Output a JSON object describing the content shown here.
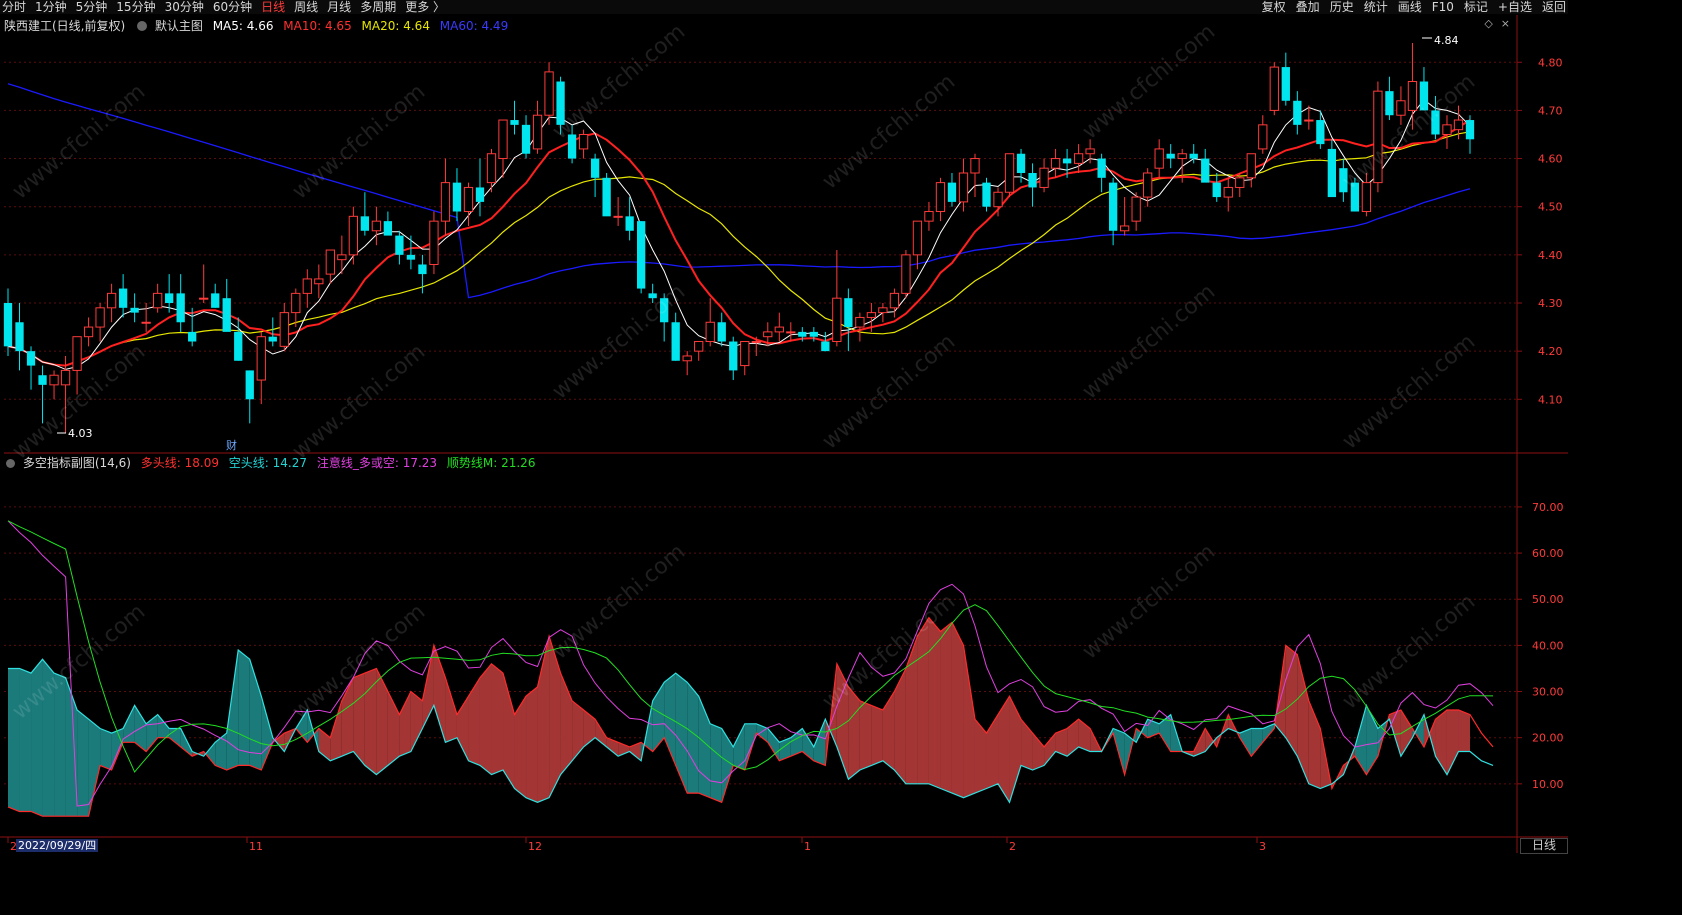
{
  "toolbar": {
    "periods": [
      "分时",
      "1分钟",
      "5分钟",
      "15分钟",
      "30分钟",
      "60分钟",
      "日线",
      "周线",
      "月线",
      "多周期",
      "更多"
    ],
    "active_period": "日线",
    "tools": [
      "复权",
      "叠加",
      "历史",
      "统计",
      "画线",
      "F10",
      "标记",
      "+自选",
      "返回"
    ]
  },
  "main_legend": {
    "stock": "陕西建工(日线,前复权)",
    "template": "默认主图",
    "ma5": "MA5: 4.66",
    "ma10": "MA10: 4.65",
    "ma20": "MA20: 4.64",
    "ma60": "MA60: 4.49"
  },
  "sub_legend": {
    "name": "多空指标副图(14,6)",
    "bull": "多头线: 18.09",
    "bear": "空头线: 14.27",
    "attention": "注意线_多或空: 17.23",
    "trend": "顺势线M: 21.26"
  },
  "price_axis": [
    "4.80",
    "4.70",
    "4.60",
    "4.50",
    "4.40",
    "4.30",
    "4.20",
    "4.10"
  ],
  "sub_axis": [
    "70.00",
    "60.00",
    "50.00",
    "40.00",
    "30.00",
    "20.00",
    "10.00"
  ],
  "annotations": {
    "high": "4.84",
    "low": "4.03",
    "event": "财"
  },
  "x_axis": {
    "labels": [
      "20",
      "11",
      "12",
      "1",
      "2",
      "3"
    ],
    "cursor_date": "2022/09/29/四"
  },
  "period_label": "日线",
  "colors": {
    "up": "#ff3b3b",
    "down": "#00e5ee",
    "ma5": "#ffffff",
    "ma10": "#ff2020",
    "ma20": "#e6e600",
    "ma60": "#1a1aff",
    "bull_fill": "#a33535",
    "bear_fill": "#1b7a7a",
    "attention": "#e040e0",
    "trend": "#22dd22"
  },
  "chart_data": {
    "type": "candlestick",
    "y_range_main": [
      4.03,
      4.84
    ],
    "y_range_sub": [
      0,
      78
    ],
    "candles": [
      [
        4.3,
        4.33,
        4.19,
        4.21
      ],
      [
        4.26,
        4.3,
        4.16,
        4.2
      ],
      [
        4.2,
        4.21,
        4.12,
        4.17
      ],
      [
        4.15,
        4.17,
        4.05,
        4.13
      ],
      [
        4.13,
        4.16,
        4.1,
        4.15
      ],
      [
        4.13,
        4.19,
        4.03,
        4.16
      ],
      [
        4.16,
        4.23,
        4.11,
        4.23
      ],
      [
        4.23,
        4.27,
        4.21,
        4.25
      ],
      [
        4.25,
        4.3,
        4.22,
        4.29
      ],
      [
        4.29,
        4.34,
        4.26,
        4.32
      ],
      [
        4.33,
        4.36,
        4.27,
        4.29
      ],
      [
        4.29,
        4.32,
        4.26,
        4.28
      ],
      [
        4.26,
        4.3,
        4.24,
        4.26
      ],
      [
        4.29,
        4.34,
        4.28,
        4.32
      ],
      [
        4.32,
        4.36,
        4.28,
        4.3
      ],
      [
        4.32,
        4.36,
        4.24,
        4.26
      ],
      [
        4.24,
        4.29,
        4.21,
        4.22
      ],
      [
        4.31,
        4.38,
        4.3,
        4.31
      ],
      [
        4.32,
        4.34,
        4.29,
        4.29
      ],
      [
        4.31,
        4.35,
        4.25,
        4.24
      ],
      [
        4.24,
        4.27,
        4.18,
        4.18
      ],
      [
        4.16,
        4.16,
        4.05,
        4.1
      ],
      [
        4.14,
        4.24,
        4.09,
        4.23
      ],
      [
        4.23,
        4.27,
        4.21,
        4.22
      ],
      [
        4.21,
        4.3,
        4.2,
        4.28
      ],
      [
        4.28,
        4.33,
        4.25,
        4.32
      ],
      [
        4.32,
        4.37,
        4.29,
        4.35
      ],
      [
        4.34,
        4.38,
        4.31,
        4.35
      ],
      [
        4.36,
        4.41,
        4.34,
        4.41
      ],
      [
        4.39,
        4.44,
        4.36,
        4.4
      ],
      [
        4.4,
        4.5,
        4.38,
        4.48
      ],
      [
        4.48,
        4.53,
        4.44,
        4.45
      ],
      [
        4.45,
        4.5,
        4.42,
        4.47
      ],
      [
        4.47,
        4.49,
        4.45,
        4.44
      ],
      [
        4.44,
        4.45,
        4.38,
        4.4
      ],
      [
        4.4,
        4.44,
        4.37,
        4.39
      ],
      [
        4.38,
        4.4,
        4.32,
        4.36
      ],
      [
        4.38,
        4.49,
        4.36,
        4.47
      ],
      [
        4.47,
        4.6,
        4.44,
        4.55
      ],
      [
        4.55,
        4.58,
        4.47,
        4.49
      ],
      [
        4.49,
        4.55,
        4.46,
        4.54
      ],
      [
        4.54,
        4.6,
        4.48,
        4.51
      ],
      [
        4.55,
        4.62,
        4.53,
        4.61
      ],
      [
        4.6,
        4.68,
        4.56,
        4.68
      ],
      [
        4.68,
        4.72,
        4.65,
        4.67
      ],
      [
        4.67,
        4.69,
        4.6,
        4.61
      ],
      [
        4.62,
        4.72,
        4.61,
        4.69
      ],
      [
        4.69,
        4.8,
        4.67,
        4.78
      ],
      [
        4.76,
        4.77,
        4.65,
        4.67
      ],
      [
        4.65,
        4.67,
        4.59,
        4.6
      ],
      [
        4.62,
        4.66,
        4.6,
        4.65
      ],
      [
        4.6,
        4.61,
        4.52,
        4.56
      ],
      [
        4.56,
        4.57,
        4.53,
        4.48
      ],
      [
        4.48,
        4.52,
        4.46,
        4.48
      ],
      [
        4.48,
        4.52,
        4.43,
        4.45
      ],
      [
        4.47,
        4.47,
        4.32,
        4.33
      ],
      [
        4.32,
        4.34,
        4.3,
        4.31
      ],
      [
        4.31,
        4.32,
        4.22,
        4.26
      ],
      [
        4.26,
        4.28,
        4.18,
        4.18
      ],
      [
        4.18,
        4.2,
        4.15,
        4.19
      ],
      [
        4.2,
        4.22,
        4.18,
        4.22
      ],
      [
        4.22,
        4.31,
        4.21,
        4.26
      ],
      [
        4.26,
        4.28,
        4.21,
        4.22
      ],
      [
        4.22,
        4.23,
        4.14,
        4.16
      ],
      [
        4.17,
        4.22,
        4.15,
        4.22
      ],
      [
        4.22,
        4.23,
        4.19,
        4.22
      ],
      [
        4.23,
        4.26,
        4.21,
        4.24
      ],
      [
        4.24,
        4.28,
        4.22,
        4.25
      ],
      [
        4.24,
        4.26,
        4.22,
        4.24
      ],
      [
        4.24,
        4.25,
        4.22,
        4.23
      ],
      [
        4.24,
        4.25,
        4.22,
        4.23
      ],
      [
        4.22,
        4.24,
        4.2,
        4.2
      ],
      [
        4.22,
        4.41,
        4.21,
        4.31
      ],
      [
        4.31,
        4.33,
        4.2,
        4.25
      ],
      [
        4.25,
        4.28,
        4.22,
        4.27
      ],
      [
        4.27,
        4.3,
        4.24,
        4.28
      ],
      [
        4.28,
        4.3,
        4.26,
        4.29
      ],
      [
        4.29,
        4.33,
        4.27,
        4.32
      ],
      [
        4.32,
        4.41,
        4.31,
        4.4
      ],
      [
        4.4,
        4.47,
        4.37,
        4.47
      ],
      [
        4.47,
        4.51,
        4.45,
        4.49
      ],
      [
        4.49,
        4.56,
        4.47,
        4.55
      ],
      [
        4.55,
        4.57,
        4.5,
        4.51
      ],
      [
        4.51,
        4.6,
        4.49,
        4.57
      ],
      [
        4.57,
        4.61,
        4.52,
        4.6
      ],
      [
        4.55,
        4.56,
        4.49,
        4.5
      ],
      [
        4.5,
        4.54,
        4.48,
        4.53
      ],
      [
        4.53,
        4.61,
        4.52,
        4.61
      ],
      [
        4.61,
        4.62,
        4.55,
        4.57
      ],
      [
        4.57,
        4.59,
        4.5,
        4.54
      ],
      [
        4.54,
        4.6,
        4.53,
        4.58
      ],
      [
        4.58,
        4.62,
        4.56,
        4.6
      ],
      [
        4.6,
        4.62,
        4.56,
        4.59
      ],
      [
        4.59,
        4.63,
        4.57,
        4.61
      ],
      [
        4.61,
        4.64,
        4.59,
        4.62
      ],
      [
        4.6,
        4.61,
        4.53,
        4.56
      ],
      [
        4.55,
        4.56,
        4.42,
        4.45
      ],
      [
        4.45,
        4.52,
        4.44,
        4.46
      ],
      [
        4.47,
        4.53,
        4.45,
        4.52
      ],
      [
        4.52,
        4.58,
        4.5,
        4.57
      ],
      [
        4.58,
        4.64,
        4.56,
        4.62
      ],
      [
        4.61,
        4.63,
        4.58,
        4.6
      ],
      [
        4.6,
        4.62,
        4.55,
        4.61
      ],
      [
        4.61,
        4.63,
        4.59,
        4.6
      ],
      [
        4.6,
        4.62,
        4.57,
        4.55
      ],
      [
        4.55,
        4.57,
        4.51,
        4.52
      ],
      [
        4.52,
        4.56,
        4.49,
        4.54
      ],
      [
        4.54,
        4.57,
        4.52,
        4.56
      ],
      [
        4.56,
        4.61,
        4.54,
        4.61
      ],
      [
        4.62,
        4.69,
        4.61,
        4.67
      ],
      [
        4.7,
        4.8,
        4.69,
        4.79
      ],
      [
        4.79,
        4.82,
        4.71,
        4.72
      ],
      [
        4.72,
        4.74,
        4.65,
        4.67
      ],
      [
        4.68,
        4.71,
        4.66,
        4.68
      ],
      [
        4.68,
        4.7,
        4.62,
        4.63
      ],
      [
        4.62,
        4.64,
        4.58,
        4.52
      ],
      [
        4.58,
        4.6,
        4.51,
        4.53
      ],
      [
        4.55,
        4.56,
        4.49,
        4.49
      ],
      [
        4.49,
        4.57,
        4.48,
        4.55
      ],
      [
        4.55,
        4.76,
        4.53,
        4.74
      ],
      [
        4.74,
        4.77,
        4.68,
        4.69
      ],
      [
        4.69,
        4.75,
        4.67,
        4.72
      ],
      [
        4.7,
        4.84,
        4.66,
        4.76
      ],
      [
        4.76,
        4.79,
        4.7,
        4.7
      ],
      [
        4.7,
        4.73,
        4.64,
        4.65
      ],
      [
        4.65,
        4.69,
        4.62,
        4.67
      ],
      [
        4.66,
        4.71,
        4.64,
        4.68
      ],
      [
        4.68,
        4.69,
        4.61,
        4.64
      ]
    ],
    "sub_series": {
      "bull": [
        5,
        4,
        4,
        3,
        3,
        3,
        3,
        3,
        14,
        13,
        19,
        19,
        17,
        20,
        20,
        18,
        16,
        17,
        14,
        13,
        14,
        14,
        13,
        19,
        21,
        22,
        19,
        22,
        20,
        28,
        33,
        34,
        35,
        30,
        25,
        30,
        28,
        40,
        33,
        25,
        29,
        33,
        36,
        34,
        25,
        29,
        31,
        42,
        34,
        28,
        26,
        24,
        20,
        19,
        18,
        19,
        17,
        20,
        14,
        8,
        8,
        7,
        6,
        14,
        13,
        21,
        19,
        15,
        16,
        17,
        15,
        14,
        36,
        31,
        28,
        27,
        26,
        30,
        35,
        42,
        46,
        43,
        45,
        40,
        24,
        21,
        25,
        29,
        24,
        21,
        18,
        21,
        22,
        24,
        22,
        17,
        21,
        12,
        22,
        20,
        21,
        17,
        17,
        17,
        22,
        18,
        25,
        20,
        16,
        19,
        22,
        40,
        38,
        28,
        22,
        9,
        14,
        16,
        12,
        16,
        25,
        26,
        22,
        18,
        24,
        26,
        26,
        25,
        21,
        18
      ],
      "bear": [
        35,
        35,
        34,
        37,
        34,
        33,
        26,
        24,
        22,
        21,
        22,
        27,
        23,
        25,
        22,
        22,
        17,
        16,
        19,
        21,
        39,
        37,
        29,
        20,
        17,
        22,
        26,
        17,
        15,
        16,
        17,
        14,
        12,
        14,
        16,
        17,
        22,
        27,
        19,
        20,
        15,
        14,
        12,
        13,
        9,
        7,
        6,
        7,
        12,
        15,
        18,
        20,
        18,
        16,
        17,
        15,
        28,
        32,
        34,
        32,
        29,
        23,
        22,
        18,
        23,
        23,
        22,
        19,
        20,
        22,
        18,
        24,
        18,
        11,
        13,
        14,
        15,
        13,
        10,
        10,
        10,
        9,
        8,
        7,
        8,
        9,
        10,
        6,
        14,
        13,
        14,
        17,
        16,
        18,
        17,
        17,
        22,
        21,
        19,
        24,
        23,
        25,
        17,
        16,
        17,
        20,
        22,
        21,
        22,
        22,
        23,
        20,
        16,
        10,
        9,
        10,
        12,
        18,
        27,
        22,
        24,
        16,
        20,
        25,
        16,
        12,
        17,
        17,
        15,
        14
      ]
    }
  }
}
